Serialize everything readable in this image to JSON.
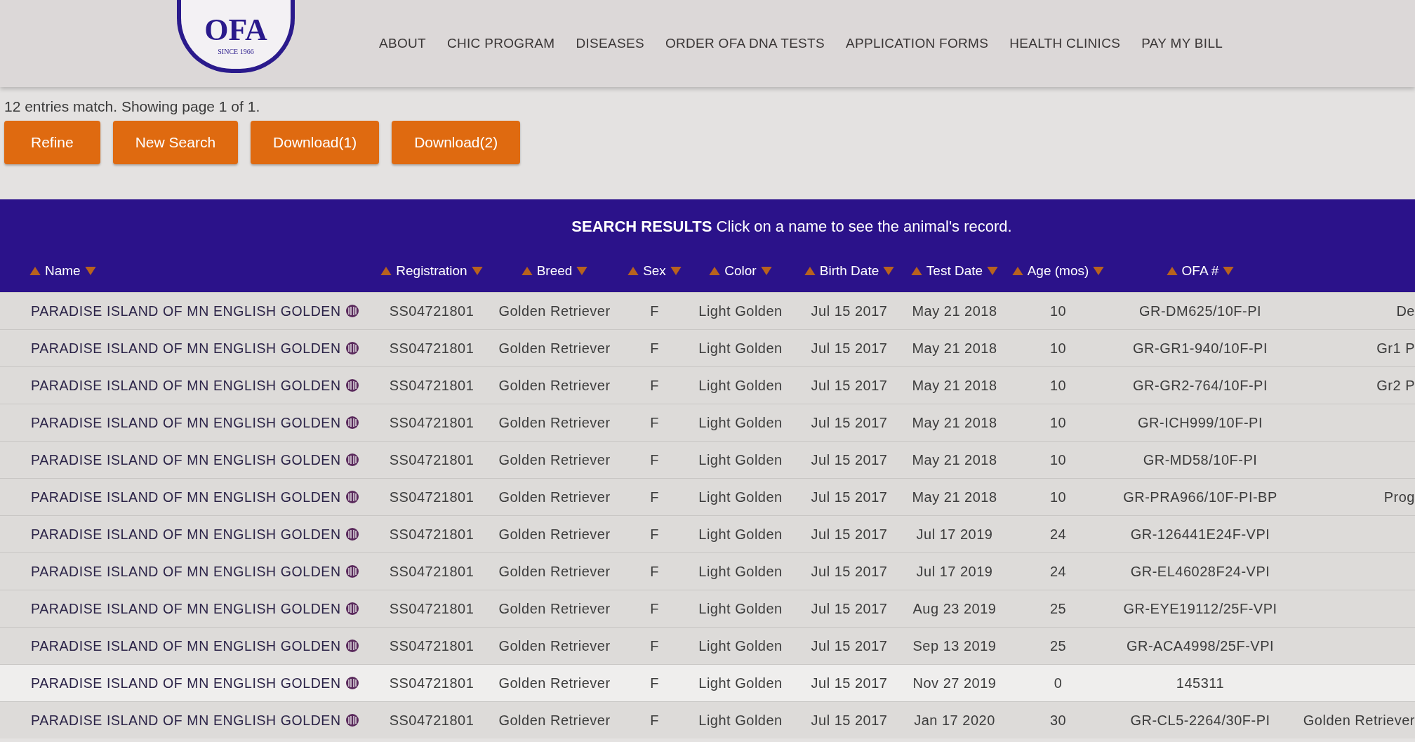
{
  "logo": {
    "text": "OFA",
    "since": "SINCE 1966"
  },
  "nav": [
    "ABOUT",
    "CHIC PROGRAM",
    "DISEASES",
    "ORDER OFA DNA TESTS",
    "APPLICATION FORMS",
    "HEALTH CLINICS",
    "PAY MY BILL"
  ],
  "summary": "12 entries match. Showing page 1 of 1.",
  "buttons": [
    "Refine",
    "New Search",
    "Download(1)",
    "Download(2)"
  ],
  "results_banner": "**SEARCH RESULTS** Click on a name to see the animal's record.",
  "table": {
    "columns": [
      "Name",
      "Registration",
      "Breed",
      "Sex",
      "Color",
      "Birth Date",
      "Test Date",
      "Age (mos)",
      "OFA #"
    ],
    "rows": [
      {
        "cells": [
          "PARADISE ISLAND OF MN ENGLISH GOLDEN",
          "SS04721801",
          "Golden Retriever",
          "F",
          "Light Golden",
          "Jul 15 2017",
          "May 21 2018",
          "10",
          "GR-DM625/10F-PI",
          "De"
        ],
        "selected": false
      },
      {
        "cells": [
          "PARADISE ISLAND OF MN ENGLISH GOLDEN",
          "SS04721801",
          "Golden Retriever",
          "F",
          "Light Golden",
          "Jul 15 2017",
          "May 21 2018",
          "10",
          "GR-GR1-940/10F-PI",
          "Gr1 P"
        ],
        "selected": false
      },
      {
        "cells": [
          "PARADISE ISLAND OF MN ENGLISH GOLDEN",
          "SS04721801",
          "Golden Retriever",
          "F",
          "Light Golden",
          "Jul 15 2017",
          "May 21 2018",
          "10",
          "GR-GR2-764/10F-PI",
          "Gr2 P"
        ],
        "selected": false
      },
      {
        "cells": [
          "PARADISE ISLAND OF MN ENGLISH GOLDEN",
          "SS04721801",
          "Golden Retriever",
          "F",
          "Light Golden",
          "Jul 15 2017",
          "May 21 2018",
          "10",
          "GR-ICH999/10F-PI"
        ],
        "selected": false
      },
      {
        "cells": [
          "PARADISE ISLAND OF MN ENGLISH GOLDEN",
          "SS04721801",
          "Golden Retriever",
          "F",
          "Light Golden",
          "Jul 15 2017",
          "May 21 2018",
          "10",
          "GR-MD58/10F-PI"
        ],
        "selected": false
      },
      {
        "cells": [
          "PARADISE ISLAND OF MN ENGLISH GOLDEN",
          "SS04721801",
          "Golden Retriever",
          "F",
          "Light Golden",
          "Jul 15 2017",
          "May 21 2018",
          "10",
          "GR-PRA966/10F-PI-BP",
          "Prog"
        ],
        "selected": false
      },
      {
        "cells": [
          "PARADISE ISLAND OF MN ENGLISH GOLDEN",
          "SS04721801",
          "Golden Retriever",
          "F",
          "Light Golden",
          "Jul 15 2017",
          "Jul 17 2019",
          "24",
          "GR-126441E24F-VPI"
        ],
        "selected": false
      },
      {
        "cells": [
          "PARADISE ISLAND OF MN ENGLISH GOLDEN",
          "SS04721801",
          "Golden Retriever",
          "F",
          "Light Golden",
          "Jul 15 2017",
          "Jul 17 2019",
          "24",
          "GR-EL46028F24-VPI"
        ],
        "selected": false
      },
      {
        "cells": [
          "PARADISE ISLAND OF MN ENGLISH GOLDEN",
          "SS04721801",
          "Golden Retriever",
          "F",
          "Light Golden",
          "Jul 15 2017",
          "Aug 23 2019",
          "25",
          "GR-EYE19112/25F-VPI"
        ],
        "selected": false
      },
      {
        "cells": [
          "PARADISE ISLAND OF MN ENGLISH GOLDEN",
          "SS04721801",
          "Golden Retriever",
          "F",
          "Light Golden",
          "Jul 15 2017",
          "Sep 13 2019",
          "25",
          "GR-ACA4998/25F-VPI"
        ],
        "selected": false
      },
      {
        "cells": [
          "PARADISE ISLAND OF MN ENGLISH GOLDEN",
          "SS04721801",
          "Golden Retriever",
          "F",
          "Light Golden",
          "Jul 15 2017",
          "Nov 27 2019",
          "0",
          "145311"
        ],
        "selected": true
      },
      {
        "cells": [
          "PARADISE ISLAND OF MN ENGLISH GOLDEN",
          "SS04721801",
          "Golden Retriever",
          "F",
          "Light Golden",
          "Jul 15 2017",
          "Jan 17 2020",
          "30",
          "GR-CL5-2264/30F-PI",
          "Golden Retriever"
        ],
        "selected": false
      }
    ]
  }
}
